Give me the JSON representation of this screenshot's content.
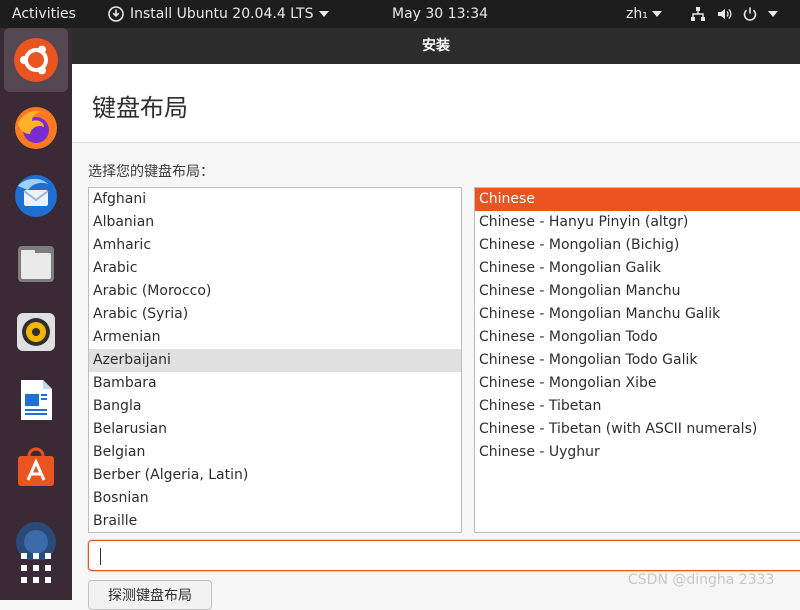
{
  "topbar": {
    "activities": "Activities",
    "app_name": "Install Ubuntu 20.04.4 LTS",
    "clock": "May 30  13:34",
    "lang": "zh₁"
  },
  "window": {
    "title": "安装",
    "heading": "键盘布局",
    "prompt": "选择您的键盘布局：",
    "detect_button": "探测键盘布局"
  },
  "layouts": [
    "Afghani",
    "Albanian",
    "Amharic",
    "Arabic",
    "Arabic (Morocco)",
    "Arabic (Syria)",
    "Armenian",
    "Azerbaijani",
    "Bambara",
    "Bangla",
    "Belarusian",
    "Belgian",
    "Berber (Algeria, Latin)",
    "Bosnian",
    "Braille"
  ],
  "variants": [
    "Chinese",
    "Chinese - Hanyu Pinyin (altgr)",
    "Chinese - Mongolian (Bichig)",
    "Chinese - Mongolian Galik",
    "Chinese - Mongolian Manchu",
    "Chinese - Mongolian Manchu Galik",
    "Chinese - Mongolian Todo",
    "Chinese - Mongolian Todo Galik",
    "Chinese - Mongolian Xibe",
    "Chinese - Tibetan",
    "Chinese - Tibetan (with ASCII numerals)",
    "Chinese - Uyghur"
  ],
  "test_input": {
    "value": ""
  },
  "watermark": "CSDN @dingha 2333",
  "colors": {
    "accent": "#e95420",
    "topbar": "#1d1d1d",
    "dock": "#3a2a36",
    "titlebar": "#2c2c2c"
  },
  "dock_icons": [
    "ubuntu-installer-icon",
    "firefox-icon",
    "thunderbird-icon",
    "files-icon",
    "rhythmbox-icon",
    "libreoffice-writer-icon",
    "software-center-icon",
    "help-icon",
    "app-grid-icon"
  ]
}
